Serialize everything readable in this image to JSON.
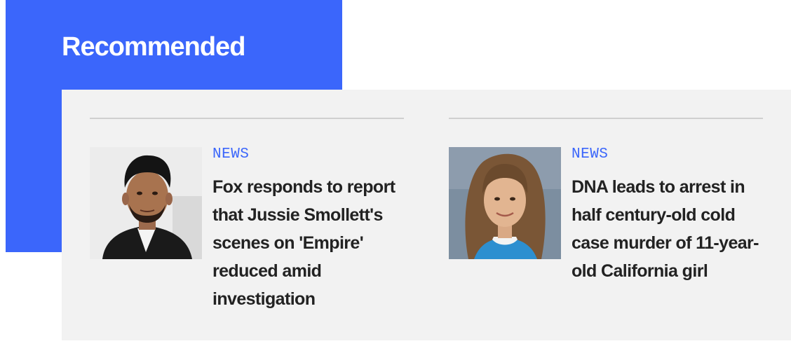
{
  "section": {
    "title": "Recommended"
  },
  "cards": [
    {
      "category": "NEWS",
      "headline": "Fox responds to report that Jussie Smollett's scenes on 'Empire' reduced amid investigation",
      "image": "portrait-photo-man"
    },
    {
      "category": "NEWS",
      "headline": "DNA leads to arrest in half century-old cold case murder of 11-year-old California girl",
      "image": "portrait-photo-girl"
    }
  ],
  "colors": {
    "accent": "#3b66fb",
    "panel": "#f2f2f2",
    "headline": "#222222",
    "divider": "#cfcfcf"
  }
}
